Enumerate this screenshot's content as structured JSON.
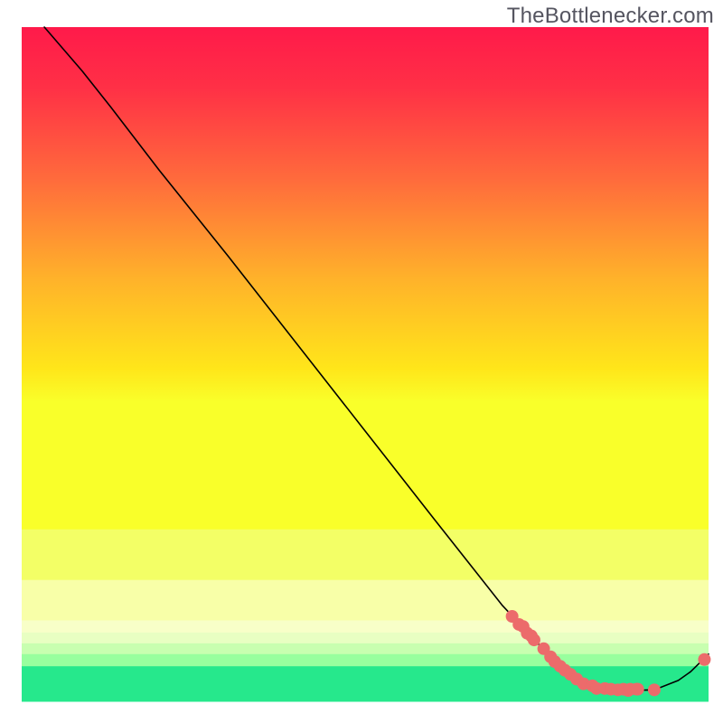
{
  "watermark": "TheBottlenecker.com",
  "chart_data": {
    "type": "line",
    "xlim": [
      0,
      100
    ],
    "ylim": [
      0,
      100
    ],
    "title": "",
    "xlabel": "",
    "ylabel": "",
    "background": {
      "kind": "vertical-gradient-with-bottom-bands",
      "gradient_stops": [
        {
          "offset": 0.0,
          "color": "#ff1a4a"
        },
        {
          "offset": 0.12,
          "color": "#ff3046"
        },
        {
          "offset": 0.3,
          "color": "#ff6a3c"
        },
        {
          "offset": 0.5,
          "color": "#ffb22a"
        },
        {
          "offset": 0.68,
          "color": "#ffe61a"
        },
        {
          "offset": 0.745,
          "color": "#f9ff2a"
        }
      ],
      "bands": [
        {
          "y_frac": 0.745,
          "h_frac": 0.075,
          "color": "#f3ff66"
        },
        {
          "y_frac": 0.82,
          "h_frac": 0.06,
          "color": "#f8ffa8"
        },
        {
          "y_frac": 0.88,
          "h_frac": 0.018,
          "color": "#f8ffc8"
        },
        {
          "y_frac": 0.898,
          "h_frac": 0.016,
          "color": "#e8ffc2"
        },
        {
          "y_frac": 0.914,
          "h_frac": 0.016,
          "color": "#c8ffb0"
        },
        {
          "y_frac": 0.93,
          "h_frac": 0.018,
          "color": "#98ff9e"
        },
        {
          "y_frac": 0.948,
          "h_frac": 0.052,
          "color": "#26e88c"
        }
      ]
    },
    "series": [
      {
        "name": "bottleneck-curve",
        "kind": "line",
        "stroke": "#000000",
        "stroke_width": 1.6,
        "x": [
          3.3,
          8.8,
          13.0,
          20.0,
          30.0,
          40.0,
          50.0,
          60.0,
          70.0,
          75.6,
          80.8,
          83.1,
          88.3,
          92.1,
          95.6,
          97.4,
          100.0
        ],
        "y": [
          100.0,
          93.5,
          88.1,
          78.8,
          66.1,
          53.1,
          40.1,
          27.1,
          14.2,
          8.1,
          3.3,
          2.3,
          1.6,
          1.7,
          3.1,
          4.4,
          7.0
        ]
      },
      {
        "name": "sample-points",
        "kind": "scatter",
        "fill": "#ec6b6b",
        "radius": 7,
        "x": [
          71.4,
          72.4,
          73.0,
          73.6,
          74.2,
          74.6,
          76.0,
          77.0,
          77.6,
          78.4,
          79.1,
          79.9,
          80.8,
          81.8,
          83.1,
          83.7,
          84.9,
          85.8,
          86.8,
          87.6,
          88.3,
          88.6,
          89.5,
          89.7,
          92.1,
          99.4
        ],
        "y": [
          12.6,
          11.4,
          11.1,
          10.1,
          9.7,
          9.1,
          7.8,
          6.6,
          5.9,
          5.2,
          4.6,
          4.0,
          3.3,
          2.6,
          2.3,
          1.9,
          1.9,
          1.8,
          1.7,
          1.8,
          1.6,
          1.8,
          1.8,
          1.8,
          1.7,
          6.2
        ]
      }
    ]
  }
}
